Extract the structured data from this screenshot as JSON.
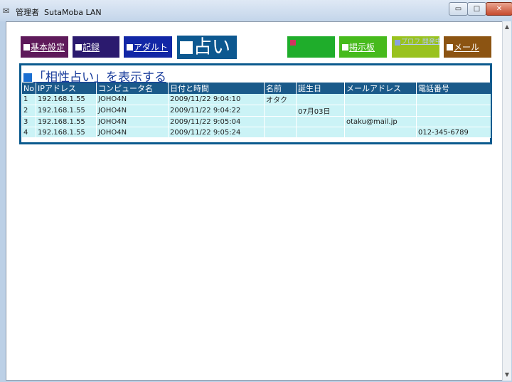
{
  "window": {
    "title": "管理者  SutaMoba LAN",
    "app_icon": "app-icon",
    "minimize": "▭",
    "maximize": "□",
    "close": "✕"
  },
  "nav": [
    {
      "label": "基本設定",
      "color": "#5e1a5a"
    },
    {
      "label": "記録",
      "color": "#2b1a6e"
    },
    {
      "label": "アダルト",
      "color": "#1227a6"
    },
    {
      "label": "占い",
      "color": "#0d5890"
    },
    {
      "label": "",
      "color": "#1fad2b"
    },
    {
      "label": "掲示板",
      "color": "#46ba1c"
    },
    {
      "label": "プロフ 開発中",
      "color": "#99c21e"
    },
    {
      "label": "メール",
      "color": "#8c5412"
    }
  ],
  "section": {
    "title": "「相性占い」を表示する"
  },
  "table": {
    "headers": [
      "No",
      "IPアドレス",
      "コンピュータ名",
      "日付と時間",
      "名前",
      "誕生日",
      "メールアドレス",
      "電話番号"
    ],
    "rows": [
      [
        "1",
        "192.168.1.55",
        "JOHO4N",
        "2009/11/22 9:04:10",
        "オタク",
        "",
        "",
        ""
      ],
      [
        "2",
        "192.168.1.55",
        "JOHO4N",
        "2009/11/22 9:04:22",
        "",
        "07月03日",
        "",
        ""
      ],
      [
        "3",
        "192.168.1.55",
        "JOHO4N",
        "2009/11/22 9:05:04",
        "",
        "",
        "otaku@mail.jp",
        ""
      ],
      [
        "4",
        "192.168.1.55",
        "JOHO4N",
        "2009/11/22 9:05:24",
        "",
        "",
        "",
        "012-345-6789"
      ]
    ]
  }
}
